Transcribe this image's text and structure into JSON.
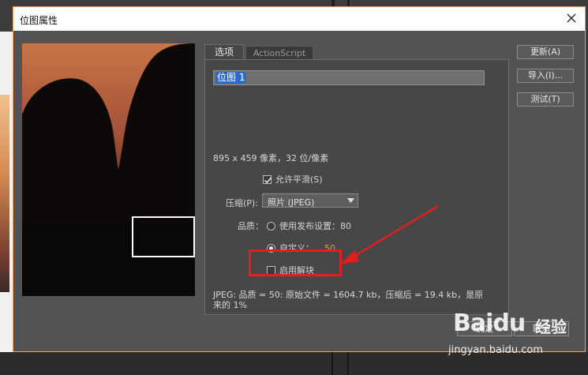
{
  "dialog": {
    "title": "位图属性",
    "close_icon": "close-icon"
  },
  "tabs": [
    {
      "label": "选项",
      "active": true
    },
    {
      "label": "ActionScript",
      "active": false
    }
  ],
  "options": {
    "bitmap_name": "位图 1",
    "dimensions_info": "895 x 459 像素，32 位/像素",
    "allow_smoothing_label": "允许平滑(S)",
    "allow_smoothing_checked": true,
    "compression_label": "压缩(P):",
    "compression_value": "照片 (JPEG)",
    "quality_label": "品质：",
    "quality_publish_label": "使用发布设置：80",
    "quality_custom_label": "自定义：",
    "quality_custom_value": "50",
    "quality_selected": "custom",
    "deblocking_label": "启用解块",
    "deblocking_checked": false,
    "jpeg_info": "JPEG: 品质 = 50: 原始文件 = 1604.7 kb，压缩后 = 19.4 kb，是原来的 1%"
  },
  "side_buttons": {
    "update": "更新(A)",
    "import": "导入(I)...",
    "test": "测试(T)"
  },
  "bottom_buttons": {
    "ok": "确定",
    "cancel": "取消"
  },
  "watermark": {
    "logo": "Baidu",
    "logo_sub": "经验",
    "url": "jingyan.baidu.com"
  },
  "colors": {
    "annotation": "#e02020",
    "custom_value": "#e8a03c",
    "selection": "#2f6ac4"
  }
}
